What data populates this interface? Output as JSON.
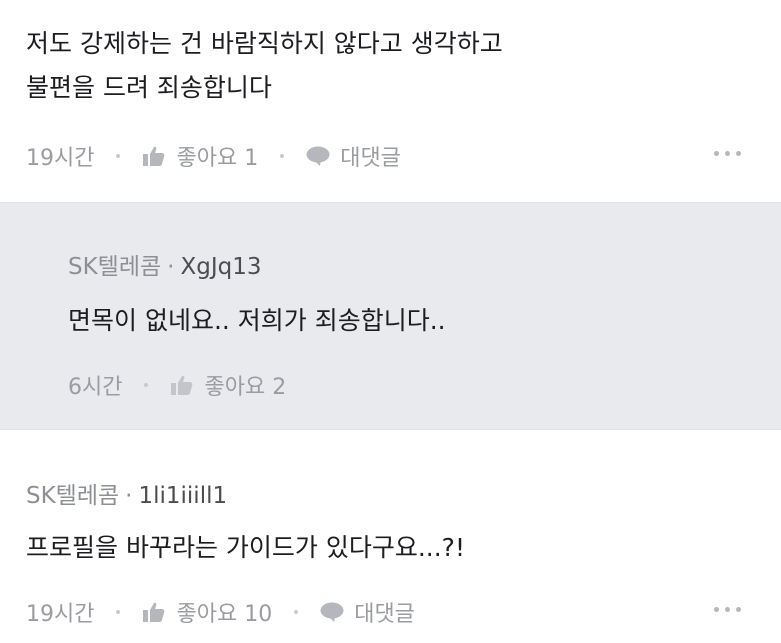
{
  "comments": [
    {
      "text_line1": "저도 강제하는 건 바람직하지 않다고 생각하고",
      "text_line2": "불편을 드려 죄송합니다",
      "time": "19시간",
      "like_label": "좋아요 1",
      "reply_label": "대댓글"
    },
    {
      "author": "SK텔레콤",
      "separator": "·",
      "user": "XgJq13",
      "text_line1": "면목이 없네요.. 저희가 죄송합니다..",
      "time": "6시간",
      "like_label": "좋아요 2"
    },
    {
      "author": "SK텔레콤",
      "separator": "·",
      "user": "1li1iiill1",
      "text_line1": "프로필을  바꾸라는 가이드가 있다구요...?!",
      "time": "19시간",
      "like_label": "좋아요 10",
      "reply_label": "대댓글"
    }
  ],
  "icons": {
    "like": "thumbs-up-icon",
    "reply": "speech-bubble-icon",
    "more": "more-options-icon"
  },
  "colors": {
    "reply_background": "#e9eaee",
    "meta_text": "#9a9ca1",
    "body_text": "#1c1d20"
  }
}
